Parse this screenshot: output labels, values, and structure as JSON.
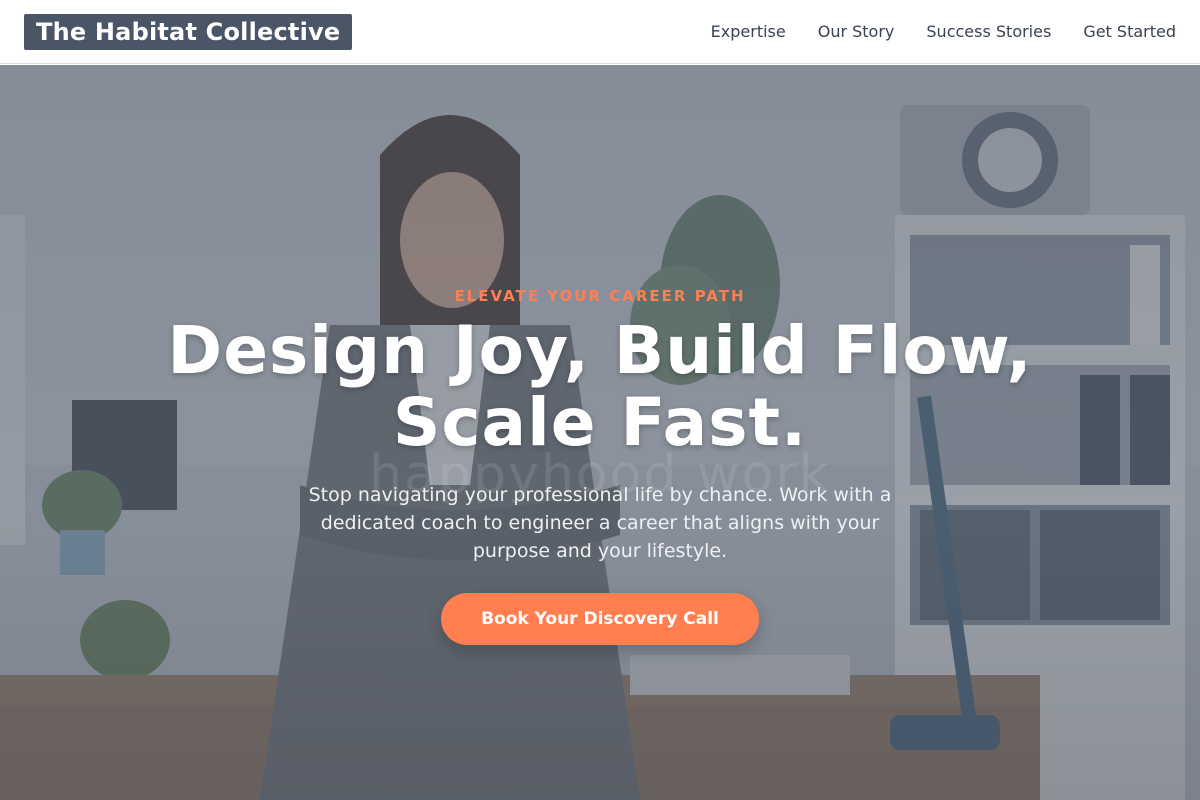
{
  "header": {
    "logo": "The Habitat Collective",
    "nav": [
      "Expertise",
      "Our Story",
      "Success Stories",
      "Get Started"
    ]
  },
  "hero": {
    "eyebrow": "ELEVATE YOUR CAREER PATH",
    "headline_line1": "Design Joy, Build Flow,",
    "headline_line2": "Scale Fast.",
    "subtext": "Stop navigating your professional life by chance. Work with a dedicated coach to engineer a career that aligns with your purpose and your lifestyle.",
    "cta_label": "Book Your Discovery Call",
    "watermark": "happyhood work"
  },
  "colors": {
    "accent": "#ff7f50",
    "logo_bg": "#4a5566",
    "overlay": "#464e5c"
  },
  "icons": {
    "background": "office-photo"
  }
}
